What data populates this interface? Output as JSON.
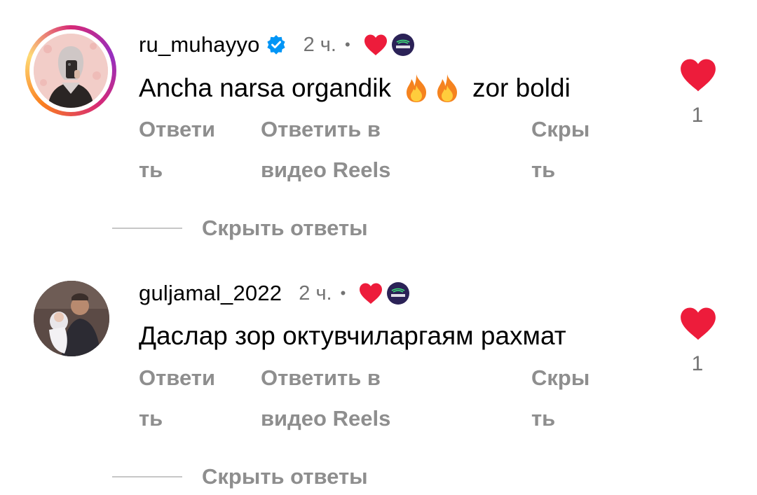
{
  "comments": [
    {
      "username": "ru_muhayyo",
      "verified": true,
      "time": "2 ч.",
      "separator": "•",
      "text_before": "Ancha narsa organdik",
      "emoji": "🔥🔥",
      "text_after": "zor boldi",
      "actions": {
        "reply_line1": "Ответи",
        "reply_line2": "ть",
        "reels_line1": "Ответить в",
        "reels_line2": "видео Reels",
        "hide_line1": "Скры",
        "hide_line2": "ть"
      },
      "like_count": "1",
      "hide_replies": "Скрыть ответы",
      "avatar_icon": "avatar-woman-mirror-selfie",
      "story_ring": true
    },
    {
      "username": "guljamal_2022",
      "verified": false,
      "time": "2 ч.",
      "separator": "•",
      "text": "Даслар зор октувчиларгаям рахмат",
      "actions": {
        "reply_line1": "Ответи",
        "reply_line2": "ть",
        "reels_line1": "Ответить в",
        "reels_line2": "видео Reels",
        "hide_line1": "Скры",
        "hide_line2": "ть"
      },
      "like_count": "1",
      "hide_replies": "Скрыть ответы",
      "avatar_icon": "avatar-man-holding-baby",
      "story_ring": false
    }
  ],
  "icons": {
    "verified": "verified-badge-icon",
    "creator_liked": "heart-filled-icon",
    "creator_badge": "talim-logo-icon",
    "like": "heart-filled-icon",
    "fire": "fire-emoji-icon"
  },
  "colors": {
    "heart": "#ed1c3b",
    "verified": "#0095f6",
    "secondary_text": "#8e8e8e",
    "badge_bg": "#2b2257"
  }
}
